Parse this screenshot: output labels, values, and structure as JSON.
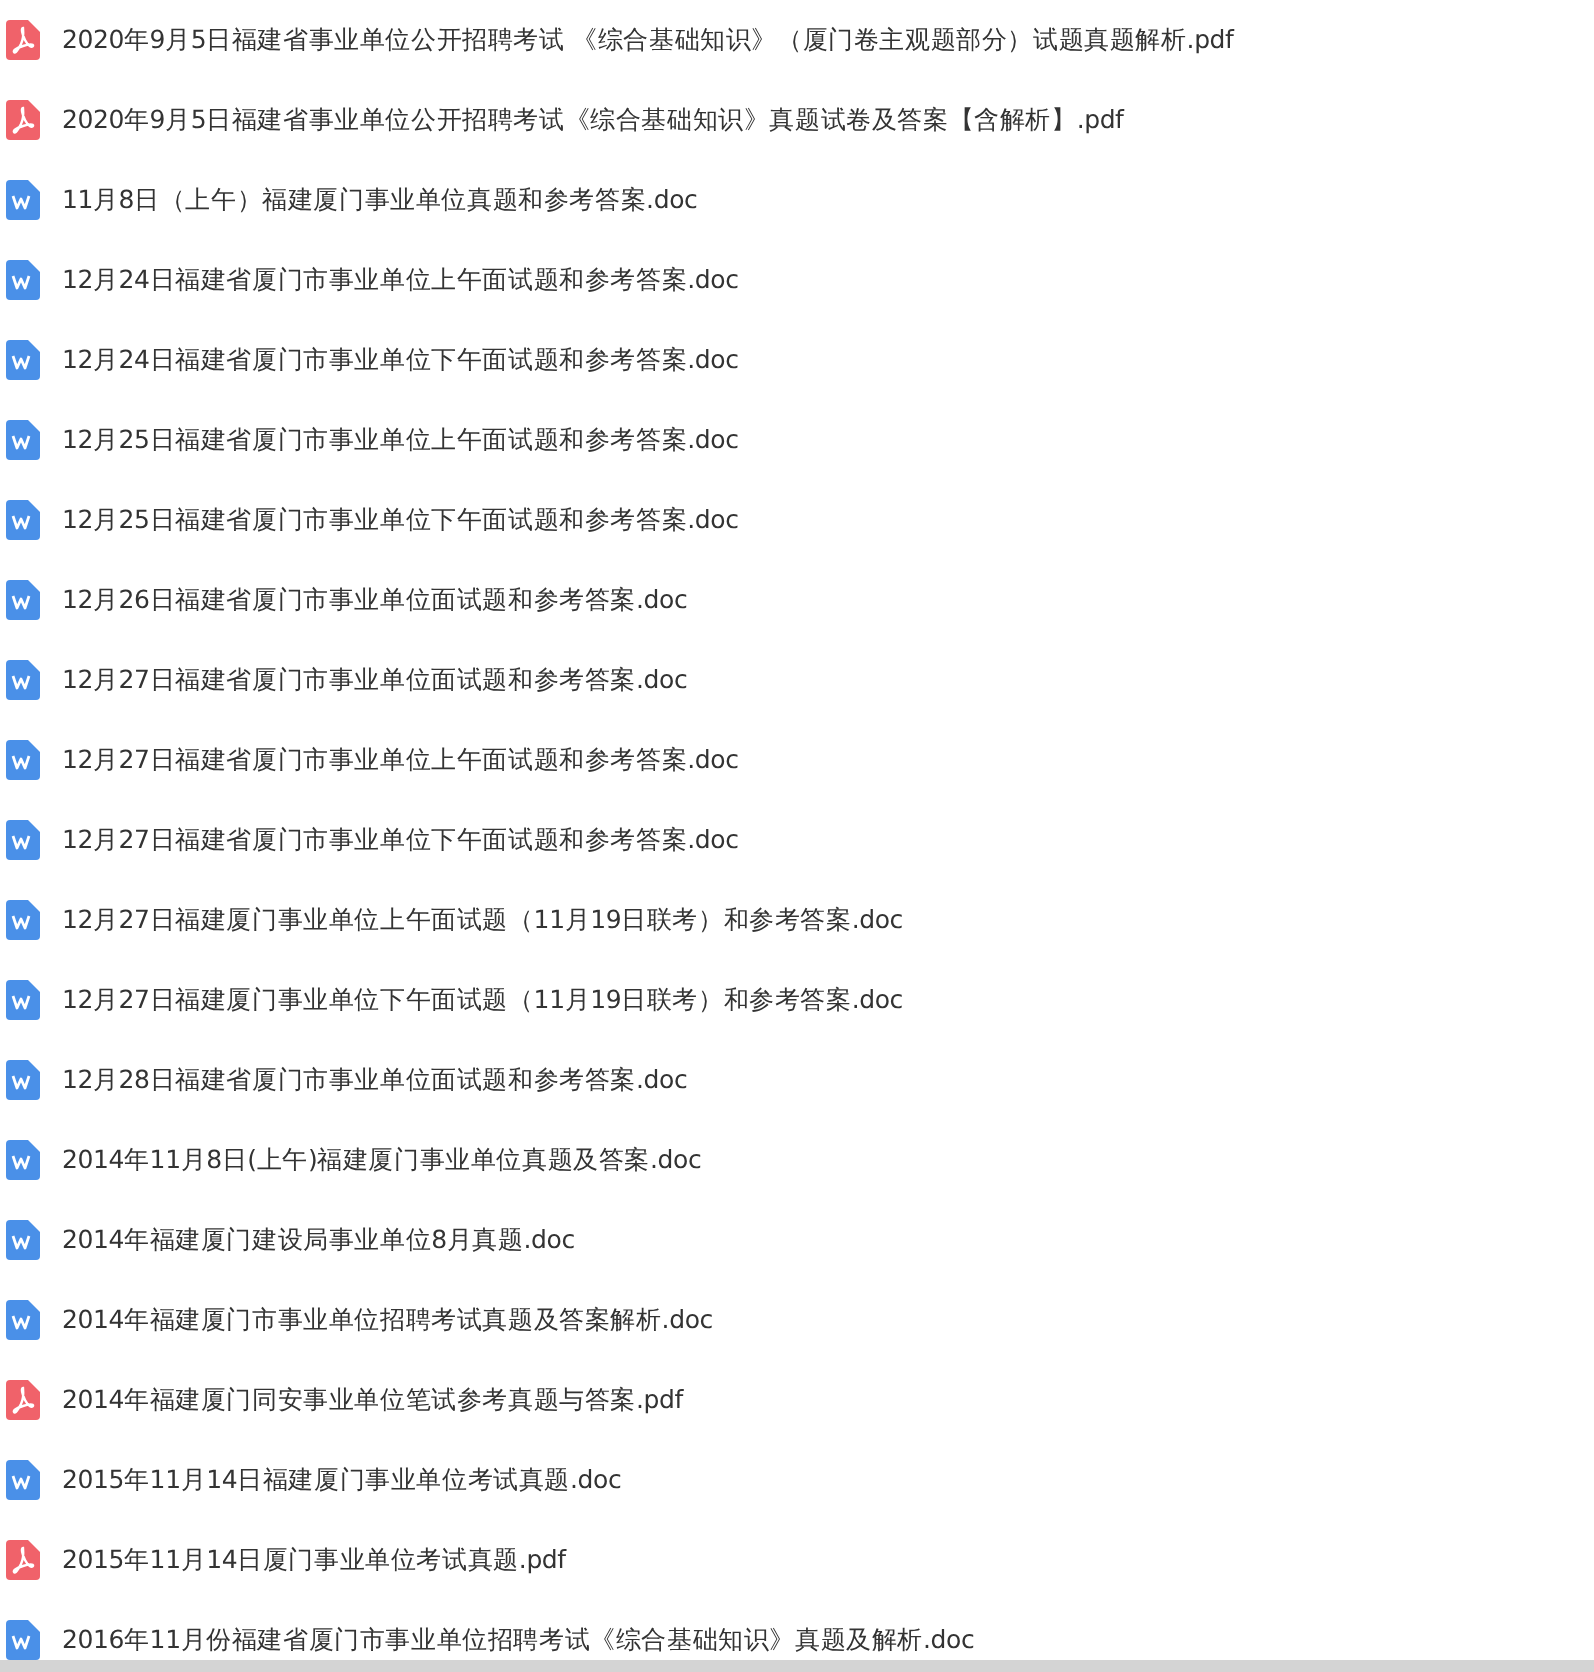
{
  "files": [
    {
      "kind": "pdf",
      "name": "2020年9月5日福建省事业单位公开招聘考试 《综合基础知识》（厦门卷主观题部分）试题真题解析.pdf"
    },
    {
      "kind": "pdf",
      "name": "2020年9月5日福建省事业单位公开招聘考试《综合基础知识》真题试卷及答案【含解析】.pdf"
    },
    {
      "kind": "doc",
      "name": "11月8日（上午）福建厦门事业单位真题和参考答案.doc"
    },
    {
      "kind": "doc",
      "name": "12月24日福建省厦门市事业单位上午面试题和参考答案.doc"
    },
    {
      "kind": "doc",
      "name": "12月24日福建省厦门市事业单位下午面试题和参考答案.doc"
    },
    {
      "kind": "doc",
      "name": "12月25日福建省厦门市事业单位上午面试题和参考答案.doc"
    },
    {
      "kind": "doc",
      "name": "12月25日福建省厦门市事业单位下午面试题和参考答案.doc"
    },
    {
      "kind": "doc",
      "name": "12月26日福建省厦门市事业单位面试题和参考答案.doc"
    },
    {
      "kind": "doc",
      "name": "12月27日福建省厦门市事业单位面试题和参考答案.doc"
    },
    {
      "kind": "doc",
      "name": "12月27日福建省厦门市事业单位上午面试题和参考答案.doc"
    },
    {
      "kind": "doc",
      "name": "12月27日福建省厦门市事业单位下午面试题和参考答案.doc"
    },
    {
      "kind": "doc",
      "name": "12月27日福建厦门事业单位上午面试题（11月19日联考）和参考答案.doc"
    },
    {
      "kind": "doc",
      "name": "12月27日福建厦门事业单位下午面试题（11月19日联考）和参考答案.doc"
    },
    {
      "kind": "doc",
      "name": "12月28日福建省厦门市事业单位面试题和参考答案.doc"
    },
    {
      "kind": "doc",
      "name": "2014年11月8日(上午)福建厦门事业单位真题及答案.doc"
    },
    {
      "kind": "doc",
      "name": "2014年福建厦门建设局事业单位8月真题.doc"
    },
    {
      "kind": "doc",
      "name": "2014年福建厦门市事业单位招聘考试真题及答案解析.doc"
    },
    {
      "kind": "pdf",
      "name": "2014年福建厦门同安事业单位笔试参考真题与答案.pdf"
    },
    {
      "kind": "doc",
      "name": "2015年11月14日福建厦门事业单位考试真题.doc"
    },
    {
      "kind": "pdf",
      "name": "2015年11月14日厦门事业单位考试真题.pdf"
    },
    {
      "kind": "doc",
      "name": "2016年11月份福建省厦门市事业单位招聘考试《综合基础知识》真题及解析.doc"
    }
  ]
}
